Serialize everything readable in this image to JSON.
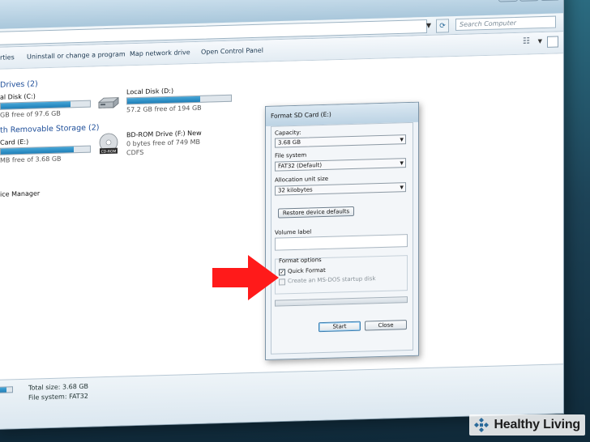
{
  "window": {
    "search_placeholder": "Search Computer",
    "controls": {
      "minimize": "—",
      "maximize": "□",
      "close": "✕"
    }
  },
  "toolbar": {
    "properties": "rties",
    "uninstall": "Uninstall or change a program",
    "map_drive": "Map network drive",
    "control_panel": "Open Control Panel"
  },
  "groups": {
    "hard_drives": "Drives (2)",
    "removable": "th Removable Storage (2)"
  },
  "drives": {
    "c": {
      "name": "al Disk (C:)",
      "free": "GB free of 97.6 GB",
      "used_fraction": 0.78
    },
    "d": {
      "name": "Local Disk (D:)",
      "free": "57.2 GB free of 194 GB",
      "used_fraction": 0.7
    },
    "e": {
      "name": "Card (E:)",
      "free": "MB free of 3.68 GB",
      "used_fraction": 0.82
    },
    "f": {
      "name": "BD-ROM Drive (F:) New",
      "free": "0 bytes free of 749 MB",
      "fs": "CDFS"
    }
  },
  "misc": {
    "device_manager": "ice Manager"
  },
  "details": {
    "total_size": "Total size: 3.68 GB",
    "file_system": "File system: FAT32"
  },
  "dialog": {
    "title": "Format SD Card (E:)",
    "capacity_label": "Capacity:",
    "capacity_value": "3.68 GB",
    "filesystem_label": "File system",
    "filesystem_value": "FAT32 (Default)",
    "alloc_label": "Allocation unit size",
    "alloc_value": "32 kilobytes",
    "restore_button": "Restore device defaults",
    "volume_label": "Volume label",
    "volume_value": "",
    "format_options": "Format options",
    "quick_format": "Quick Format",
    "quick_format_checked": true,
    "msdos": "Create an MS-DOS startup disk",
    "msdos_checked": false,
    "start_button": "Start",
    "close_button": "Close"
  },
  "watermark": {
    "brand": "Healthy Living"
  },
  "colors": {
    "arrow": "#ff1a1a",
    "accent": "#1f7fb8",
    "brand": "#2a6a9a"
  }
}
